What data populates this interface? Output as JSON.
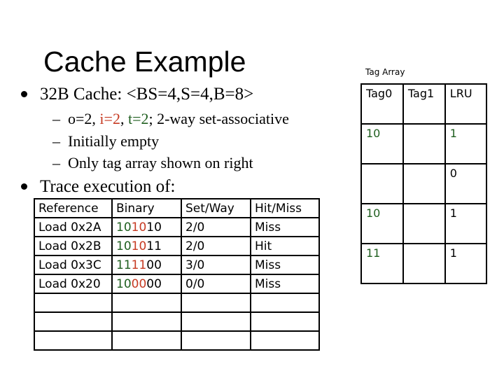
{
  "slide": {
    "title": "Cache Example",
    "bullets": [
      {
        "text": "32B Cache: <BS=4,S=4,B=8>"
      },
      {
        "text": "Trace execution of:"
      }
    ],
    "sub_bullets": {
      "params": {
        "o": "o=2, ",
        "i": "i=2",
        "sep": ", ",
        "t": "t=2",
        "rest": "; 2-way set-associative"
      },
      "initial": "Initially empty",
      "only_tag": "Only tag array shown on right"
    }
  },
  "colors": {
    "index": "#c63a22",
    "tag": "#1f5f1f"
  },
  "trace_table": {
    "headers": [
      "Reference",
      "Binary",
      "Set/Way",
      "Hit/Miss"
    ],
    "rows": [
      {
        "ref": "Load 0x2A",
        "bin_tag": "10",
        "bin_index": "10",
        "bin_offset": "10",
        "setway": "2/0",
        "hitmiss": "Miss"
      },
      {
        "ref": "Load 0x2B",
        "bin_tag": "10",
        "bin_index": "10",
        "bin_offset": "11",
        "setway": "2/0",
        "hitmiss": "Hit"
      },
      {
        "ref": "Load 0x3C",
        "bin_tag": "11",
        "bin_index": "11",
        "bin_offset": "00",
        "setway": "3/0",
        "hitmiss": "Miss"
      },
      {
        "ref": "Load 0x20",
        "bin_tag": "10",
        "bin_index": "00",
        "bin_offset": "00",
        "setway": "0/0",
        "hitmiss": "Miss"
      }
    ],
    "empty_rows": 3
  },
  "tag_array": {
    "caption": "Tag Array",
    "headers": [
      "Tag0",
      "Tag1",
      "LRU"
    ],
    "rows": [
      {
        "tag0": "10",
        "tag1": "",
        "lru": "1"
      },
      {
        "tag0": "",
        "tag1": "",
        "lru": "0"
      },
      {
        "tag0": "10",
        "tag1": "",
        "lru": "1"
      },
      {
        "tag0": "11",
        "tag1": "",
        "lru": "1"
      }
    ]
  }
}
